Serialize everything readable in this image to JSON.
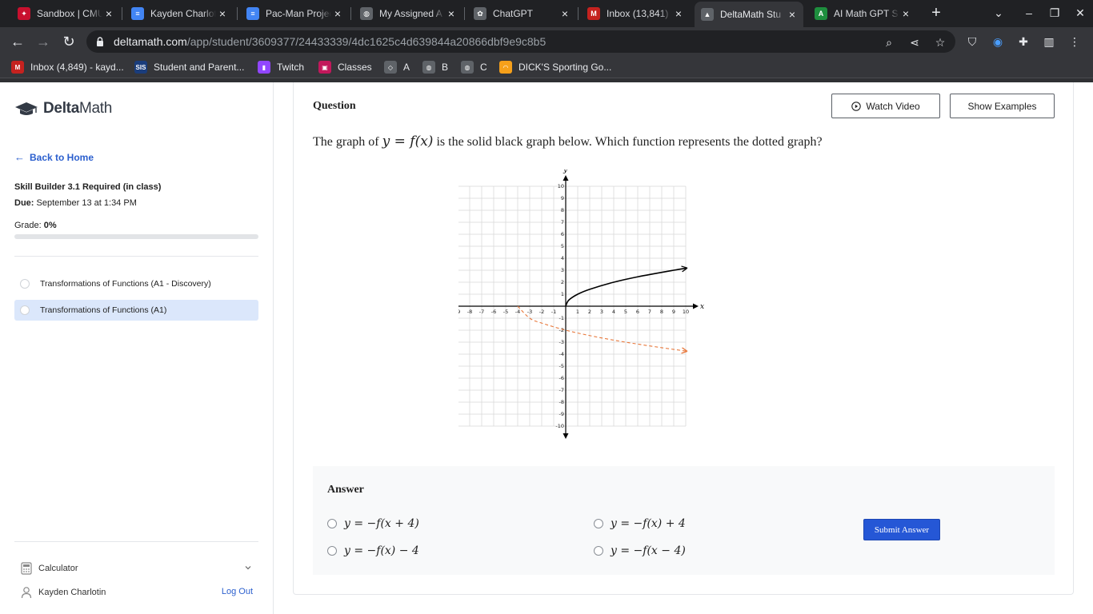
{
  "browser": {
    "tabs": [
      {
        "title": "Sandbox | CMU",
        "icon": "cmu-icon",
        "color": "#c8102e",
        "glyph": "✦"
      },
      {
        "title": "Kayden Charlotin",
        "icon": "docs-icon",
        "color": "#4285f4",
        "glyph": "≡"
      },
      {
        "title": "Pac-Man Project",
        "icon": "docs-icon",
        "color": "#4285f4",
        "glyph": "≡"
      },
      {
        "title": "My Assigned A",
        "icon": "globe-icon",
        "color": "#5f6368",
        "glyph": "◍"
      },
      {
        "title": "ChatGPT",
        "icon": "chatgpt-icon",
        "color": "#5f6368",
        "glyph": "✿"
      },
      {
        "title": "Inbox (13,841)",
        "icon": "gmail-icon",
        "color": "#c5221f",
        "glyph": "M"
      },
      {
        "title": "DeltaMath Stu",
        "icon": "deltamath-icon",
        "color": "#5f6368",
        "glyph": "▲"
      },
      {
        "title": "AI Math GPT S",
        "icon": "aimath-icon",
        "color": "#1e8e3e",
        "glyph": "A"
      }
    ],
    "active_tab": 6,
    "url_host": "deltamath.com",
    "url_path": "/app/student/3609377/24433339/4dc1625c4d639844a20866dbf9e9c8b5",
    "bookmarks": [
      {
        "label": "Inbox (4,849) - kayd...",
        "icon": "gmail-icon",
        "color": "#c5221f",
        "glyph": "M"
      },
      {
        "label": "Student and Parent...",
        "icon": "sis-icon",
        "color": "#1a3d7c",
        "glyph": "SIS"
      },
      {
        "label": "Twitch",
        "icon": "twitch-icon",
        "color": "#9146ff",
        "glyph": "▮"
      },
      {
        "label": "Classes",
        "icon": "classes-icon",
        "color": "#c2185b",
        "glyph": "▣"
      },
      {
        "label": "A",
        "icon": "shield-icon",
        "color": "#5f6368",
        "glyph": "◇"
      },
      {
        "label": "B",
        "icon": "globe-icon",
        "color": "#5f6368",
        "glyph": "◍"
      },
      {
        "label": "C",
        "icon": "globe-icon",
        "color": "#5f6368",
        "glyph": "◍"
      },
      {
        "label": "DICK'S Sporting Go...",
        "icon": "dicks-icon",
        "color": "#f6a01a",
        "glyph": "◠"
      }
    ]
  },
  "sidebar": {
    "logo_delta": "Delta",
    "logo_math": "Math",
    "back_label": "Back to Home",
    "assignment_title": "Skill Builder 3.1 Required (in class)",
    "due_label": "Due:",
    "due_value": " September 13 at 1:34 PM",
    "grade_label": "Grade:",
    "grade_value": "0%",
    "grade_fraction": 0,
    "skills": [
      {
        "label": "Transformations of Functions (A1 - Discovery)",
        "active": false
      },
      {
        "label": "Transformations of Functions (A1)",
        "active": true
      }
    ],
    "calculator_label": "Calculator",
    "user_name": "Kayden Charlotin",
    "logout_label": "Log Out"
  },
  "question": {
    "label": "Question",
    "watch_video": "Watch Video",
    "show_examples": "Show Examples",
    "text_pre": "The graph of ",
    "text_math": "y = f(x)",
    "text_post": " is the solid black graph below. Which function represents the dotted graph?"
  },
  "chart_data": {
    "type": "line",
    "xlabel": "x",
    "ylabel": "y",
    "xlim": [
      -10,
      10
    ],
    "ylim": [
      -10,
      10
    ],
    "grid": true,
    "x_ticks": [
      -10,
      -9,
      -8,
      -7,
      -6,
      -5,
      -4,
      -3,
      -2,
      -1,
      1,
      2,
      3,
      4,
      5,
      6,
      7,
      8,
      9,
      10
    ],
    "y_ticks": [
      -10,
      -9,
      -8,
      -7,
      -6,
      -5,
      -4,
      -3,
      -2,
      -1,
      1,
      2,
      3,
      4,
      5,
      6,
      7,
      8,
      9,
      10
    ],
    "series": [
      {
        "style": "solid",
        "color": "#000000",
        "x": [
          0,
          0.25,
          1,
          2,
          4,
          6,
          9,
          10
        ],
        "y": [
          0,
          0.5,
          1,
          1.41,
          2,
          2.45,
          3,
          3.16
        ]
      },
      {
        "style": "dotted",
        "color": "#e8773a",
        "x": [
          -4,
          -3,
          -2,
          0,
          2,
          4,
          6,
          8,
          10
        ],
        "y": [
          0,
          -1,
          -1.41,
          -2,
          -2.45,
          -2.83,
          -3.16,
          -3.46,
          -3.74
        ]
      }
    ]
  },
  "answer": {
    "label": "Answer",
    "options": [
      "y = −f(x + 4)",
      "y = −f(x) + 4",
      "y = −f(x) − 4",
      "y = −f(x − 4)"
    ],
    "submit_label": "Submit Answer"
  }
}
